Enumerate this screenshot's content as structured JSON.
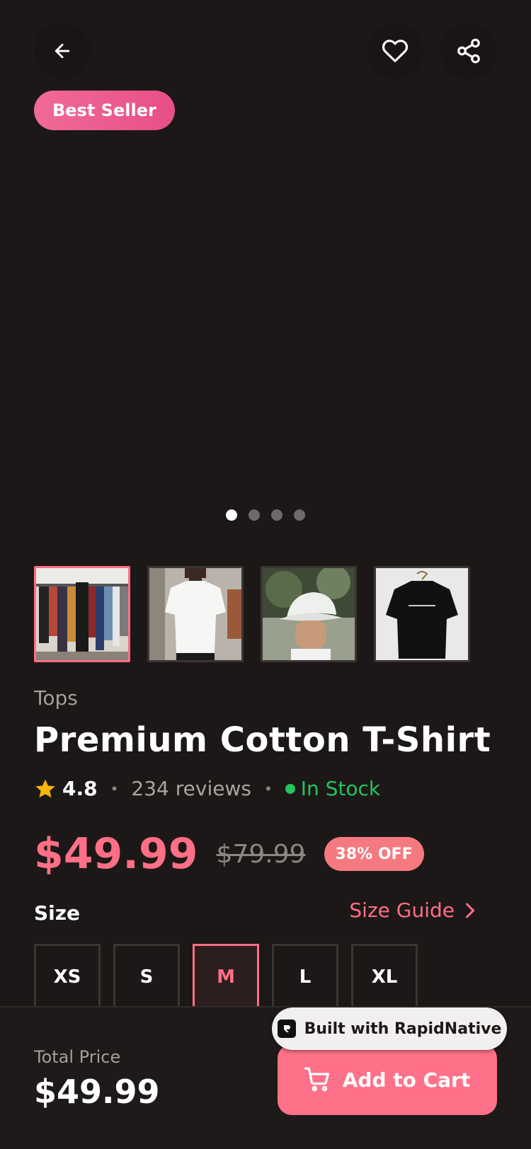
{
  "badge": "Best Seller",
  "carousel": {
    "count": 4,
    "active": 0
  },
  "thumbnails": [
    "clothing-rack",
    "white-tshirt",
    "white-cap",
    "black-tshirt"
  ],
  "product": {
    "category": "Tops",
    "title": "Premium Cotton T-Shirt",
    "rating": "4.8",
    "reviews": "234 reviews",
    "stock": "In Stock",
    "price": "$49.99",
    "old_price": "$79.99",
    "discount": "38% OFF"
  },
  "size_section": {
    "label": "Size",
    "guide": "Size Guide",
    "options": [
      "XS",
      "S",
      "M",
      "L",
      "XL"
    ],
    "selected": "M"
  },
  "footer": {
    "total_label": "Total Price",
    "total": "$49.99",
    "cta": "Add to Cart"
  },
  "builder_badge": "Built with RapidNative",
  "colors": {
    "accent": "#ff6f86",
    "background": "#1c1817",
    "stock": "#22c55e"
  }
}
